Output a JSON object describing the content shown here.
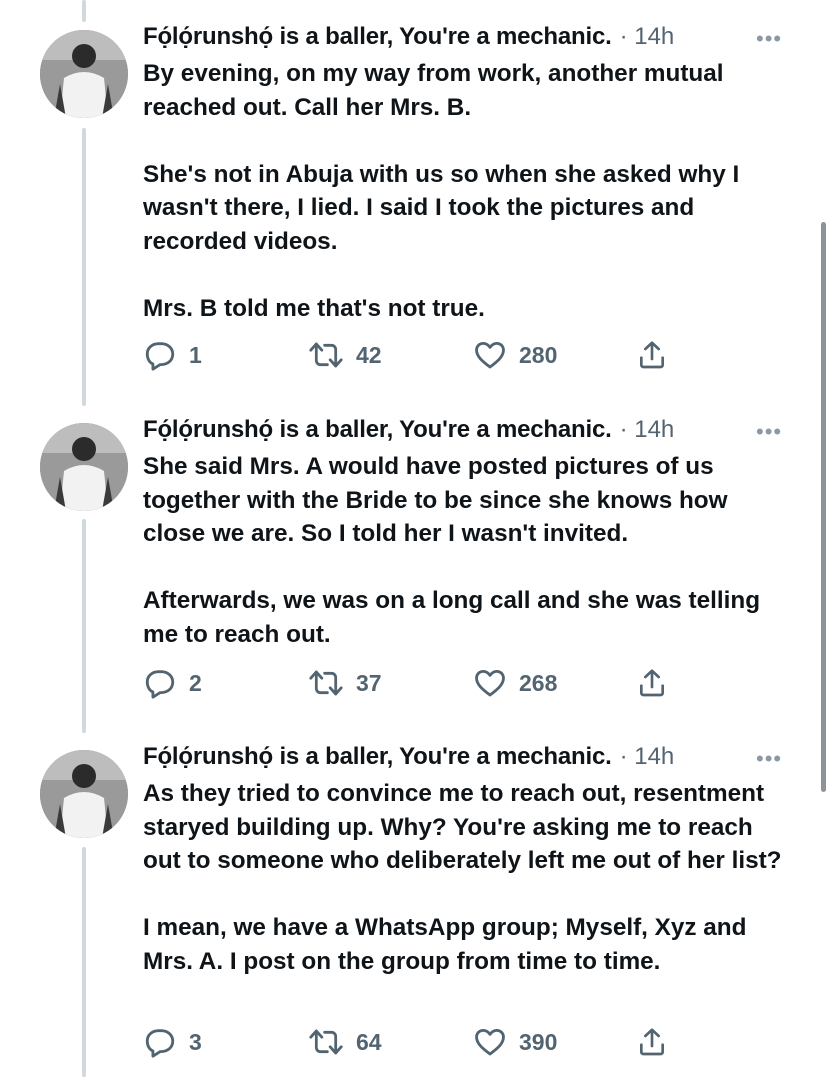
{
  "tweets": [
    {
      "author": "Fọ́lọ́runshọ́ is a baller, You're a mechanic.",
      "time": "· 14h",
      "more": "•••",
      "text": "By evening, on my way from work, another mutual reached out. Call her Mrs. B.\n\nShe's not in Abuja with us so when she asked why I wasn't there, I lied. I said I took the pictures and recorded videos.\n\nMrs. B told me that's not true.",
      "replies": "1",
      "retweets": "42",
      "likes": "280"
    },
    {
      "author": "Fọ́lọ́runshọ́ is a baller, You're a mechanic.",
      "time": "· 14h",
      "more": "•••",
      "text": "She said Mrs. A would have posted pictures of us together with the Bride to be since she knows how close we are. So I told her I wasn't invited.\n\nAfterwards, we was on a long call and she was telling me to reach out.",
      "replies": "2",
      "retweets": "37",
      "likes": "268"
    },
    {
      "author": "Fọ́lọ́runshọ́ is a baller, You're a mechanic.",
      "time": "· 14h",
      "more": "•••",
      "text": "As they tried to convince me to reach out, resentment staryed building up. Why? You're asking me to reach out to someone who deliberately left me out of her list?\n\nI mean, we have a WhatsApp group; Myself, Xyz and Mrs. A. I post on the group from time to time.",
      "replies": "3",
      "retweets": "64",
      "likes": "390"
    }
  ],
  "icons": {
    "reply": "reply-icon",
    "retweet": "retweet-icon",
    "like": "like-icon",
    "share": "share-icon",
    "more": "more-icon"
  },
  "colors": {
    "text": "#0f1419",
    "muted": "#536471",
    "thread_line": "#cfd9de"
  }
}
